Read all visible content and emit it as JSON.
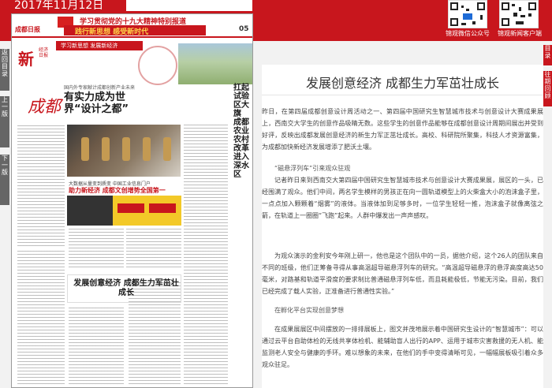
{
  "header": {
    "date": "2017年11月12日",
    "qr_labels": [
      "锦观微信公众号",
      "锦观新闻客户端"
    ]
  },
  "left_tabs": [
    "返回目录",
    "上一版",
    "下一版"
  ],
  "right_tabs": [
    "目录",
    "往期回顾"
  ],
  "paper": {
    "logo": "成都日报",
    "masthead_title": "学习贯彻党的十九大精神特别报道",
    "masthead_sub": "践行新思想 感受新时代",
    "page_number": "05",
    "section_mark": "新",
    "section_side": "经济日报",
    "section_tag": "学习新思想 发展新经济",
    "kicker": "国内外专家献计成都创新产业未来",
    "headline_main": "有实力成为世界“设计之都”",
    "cheng_char": "成都",
    "ad_line": "大数据从量变到质变 中国工业信息门户",
    "ad_head": "助力新经济 成都文创增势全国第一",
    "headline_mid": "发展创意经济 成都生力军茁壮成长",
    "side_headline": [
      "扛起试验区大旗",
      "成都农业农村改革进入深水区"
    ]
  },
  "article": {
    "title": "发展创意经济 成都生力军茁壮成长",
    "paragraphs": [
      "昨日，在第四届成都创意设计周活动之一、第四届中国研究生智慧城市技术与创意设计大赛成果展上，西南交大学生的创意作品吸睛无数。这些学生的创意作品能够在成都创意设计周期间展出并受到好评，反映出成都发展创意经济的新生力军正茁壮成长。高校、科研院所聚集，科技人才资源富集，为成都加快新经济发展增添了肥沃土壤。",
      "“磁悬浮列车”引来观众驻观",
      "记者昨日来到西南交大第四届中国研究生智慧城市技术与创意设计大赛成果展，展区的一头，已经围满了观众。他们中间，两名学生模样的男孩正在向一圆轨道模型上的火柴盒大小的泡沫盒子里，一点点加入颗颗着“烟雾”的液体。当液体加到足够多时，一位学生轻轻一推，泡沫盒子就像离弦之箭，在轨道上一圈圈“飞跑”起来。人群中爆发出一声声感叹。",
      "为观众演示的金利安今年刚上研一，他也是这个团队中的一员，据他介绍，这个26人的团队来自不同的班级，他们正筹备寻得从事高温超导磁悬浮列车的研究。“高温超导磁悬浮的悬浮高度高达50毫米，对路基和轨道平滑度的要求制比普通磁悬浮列车低，而且耗能极低，节能无污染。目前，我们已经完成了载人实验，正准备进行普通性实验。”",
      "在孵化平台实现创意梦想",
      "在成果展展区中间摆放的一排排展板上，图文并茂地展示着中国研究生设计的“智慧城市”：可以通过云平台自助体检的无线共享体检机、能辅助盲人出行的APP、运用于城市灾害救援的无人机、能监测老人安全与健康的手环。难以想象的未来，在他们的手中变得清晰可见，一幅幅展板吸引着众多观众驻足。"
    ]
  },
  "colors": {
    "brand_red": "#c8161d",
    "gold": "#ffd24a",
    "ad_yellow": "#f3c928"
  }
}
